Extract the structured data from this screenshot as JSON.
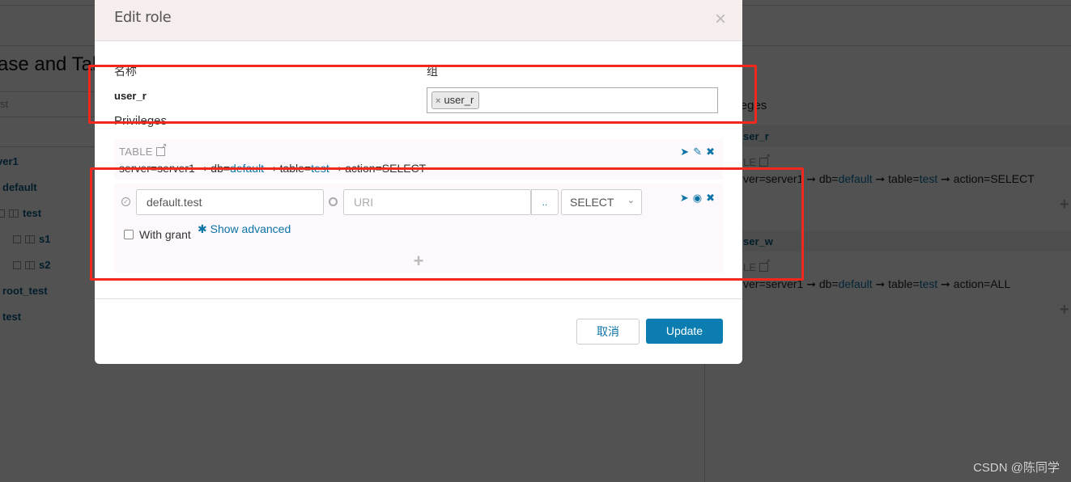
{
  "background": {
    "left_title": "ase and Tab",
    "left_search_value": "st",
    "tree": [
      {
        "label": "ver1",
        "level": 0
      },
      {
        "label": "default",
        "level": 1
      },
      {
        "label": "test",
        "level": 2,
        "icon": "table-icon"
      },
      {
        "label": "s1",
        "level": 3,
        "icon": "column-icon"
      },
      {
        "label": "s2",
        "level": 3,
        "icon": "column-icon"
      },
      {
        "label": "root_test",
        "level": 1
      },
      {
        "label": "test",
        "level": 1
      }
    ],
    "right_title": "ileges",
    "roles": [
      {
        "name": "ser_r",
        "type": "LE",
        "path": {
          "server_prefix": "ver=server1",
          "db_label": "db=",
          "db": "default",
          "table_label": "table=",
          "table": "test",
          "action": "action=SELECT"
        }
      },
      {
        "name": "ser_w",
        "type": "LE",
        "path": {
          "server_prefix": "ver=server1",
          "db_label": "db=",
          "db": "default",
          "table_label": "table=",
          "table": "test",
          "action": "action=ALL"
        }
      }
    ],
    "add_icon": "+",
    "arrow": "➞"
  },
  "modal": {
    "title": "Edit role",
    "close_icon": "×",
    "name_label": "名称",
    "name_value": "user_r",
    "group_label": "组",
    "group_tags": [
      {
        "label": "user_r",
        "remove_icon": "×"
      }
    ],
    "privileges_label": "Privileges",
    "existing_privilege": {
      "type": "TABLE",
      "path": {
        "server": "server=server1",
        "db_label": "db=",
        "db": "default",
        "table_label": "table=",
        "table": "test",
        "action": "action=SELECT"
      },
      "actions": {
        "send": "➤",
        "edit": "✎",
        "delete": "✖"
      }
    },
    "editing_privilege": {
      "db_table_value": "default.test",
      "uri_placeholder": "URI",
      "browse_label": "..",
      "action_selected": "SELECT",
      "with_grant_label": "With grant",
      "with_grant_checked": false,
      "show_advanced_label": "Show advanced",
      "actions": {
        "send": "➤",
        "view": "◉",
        "delete": "✖"
      }
    },
    "add_privilege_icon": "+",
    "cancel_label": "取消",
    "update_label": "Update"
  },
  "watermark": "CSDN @陈同学",
  "colors": {
    "accent": "#0b7db0",
    "link": "#0b74a6",
    "annotation": "#f0281e",
    "header_bg": "#f6eded"
  }
}
